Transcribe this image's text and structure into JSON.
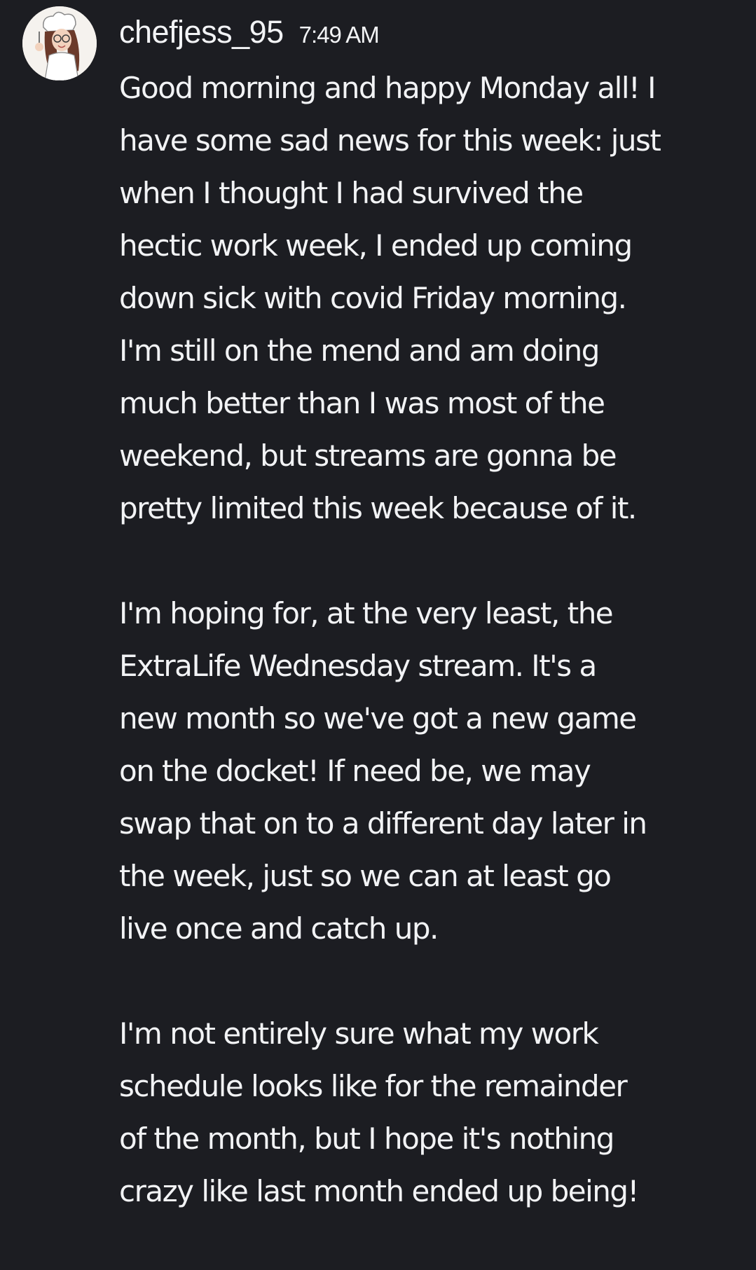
{
  "message": {
    "author": "chefjess_95",
    "timestamp": "7:49 AM",
    "avatar_icon": "chef-avatar",
    "paragraphs": [
      {
        "lines": [
          "Good morning and happy Monday all! I",
          "have some sad news for this week: just",
          "when I thought I had survived the",
          "hectic work week, I ended up coming",
          "down sick with covid Friday morning.",
          "I'm still on the mend and am doing",
          "much better than I was most of the",
          "weekend, but streams are gonna be",
          "pretty limited this week because of it."
        ]
      },
      {
        "lines": [
          "I'm hoping for, at the very least, the",
          "ExtraLife Wednesday stream. It's a",
          "new month so we've got a new game",
          "on the docket! If need be, we may",
          "swap that on to a different day later in",
          "the week, just so we can at least go",
          "live once and catch up."
        ]
      },
      {
        "lines": [
          "I'm not entirely sure what my work",
          "schedule looks like for the remainder",
          "of the month, but I hope it's nothing",
          "crazy like last month ended up being!"
        ]
      }
    ]
  },
  "colors": {
    "background": "#1c1d22",
    "text": "#f2f3f5"
  }
}
